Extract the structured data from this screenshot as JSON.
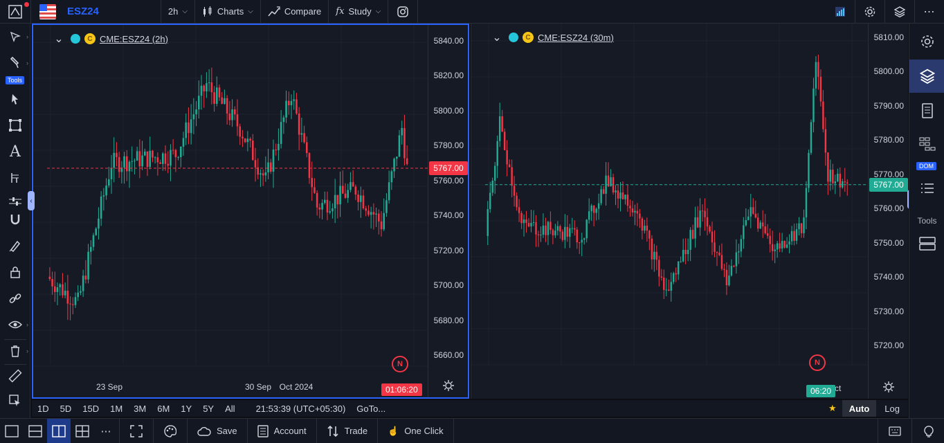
{
  "toolbar": {
    "symbol": "ESZ24",
    "interval": "2h",
    "charts_label": "Charts",
    "compare_label": "Compare",
    "study_label": "Study"
  },
  "left_tools": {
    "tools_badge": "Tools"
  },
  "charts": [
    {
      "title": "CME:ESZ24 (2h)",
      "last_price": "5767.00",
      "last_price_value": 5767,
      "countdown": "01:06:20",
      "accent": "#f23645",
      "price_ticks": [
        "5840.00",
        "5820.00",
        "5800.00",
        "5780.00",
        "5760.00",
        "5740.00",
        "5720.00",
        "5700.00",
        "5680.00",
        "5660.00"
      ],
      "time_labels": [
        "23 Sep",
        "30 Sep",
        "Oct 2024"
      ],
      "ylim": [
        5655,
        5845
      ]
    },
    {
      "title": "CME:ESZ24 (30m)",
      "last_price": "5767.00",
      "last_price_value": 5767,
      "countdown": "06:20",
      "accent": "#22ab94",
      "price_ticks": [
        "5810.00",
        "5800.00",
        "5790.00",
        "5780.00",
        "5770.00",
        "5760.00",
        "5750.00",
        "5740.00",
        "5730.00",
        "5720.00"
      ],
      "time_labels": [
        "7 Oct"
      ],
      "ylim": [
        5714,
        5812
      ]
    }
  ],
  "right_tools": {
    "dom_badge": "DOM",
    "tools_label": "Tools"
  },
  "range_bar": {
    "ranges": [
      "1D",
      "5D",
      "15D",
      "1M",
      "3M",
      "6M",
      "1Y",
      "5Y",
      "All"
    ],
    "clock": "21:53:39 (UTC+05:30)",
    "goto": "GoTo...",
    "auto": "Auto",
    "log": "Log"
  },
  "bottom_bar": {
    "save": "Save",
    "account": "Account",
    "trade": "Trade",
    "one_click": "One Click"
  },
  "colors": {
    "up": "#22ab94",
    "down": "#f23645",
    "accent": "#2962ff"
  },
  "news_badge": "N"
}
